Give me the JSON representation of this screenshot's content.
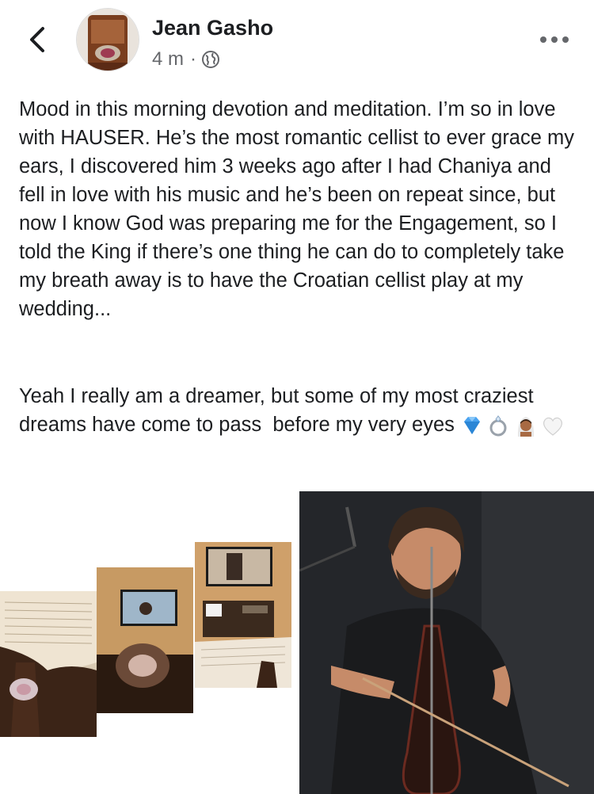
{
  "post": {
    "author_name": "Jean Gasho",
    "timestamp": "4 m",
    "separator": "·",
    "privacy_icon": "globe-icon",
    "paragraph1": "Mood in this morning devotion and meditation. I’m so in love with HAUSER. He’s the most romantic cellist to ever grace my ears, I discovered him 3 weeks ago after I had Chaniya and fell in love with his music and he’s been on repeat since, but now I know God was preparing me for the Engagement, so I told the King if there’s one thing he can do to completely take my breath away is to have the Croatian cellist play at my wedding...",
    "paragraph2": "Yeah I really am a dreamer, but some of my most craziest dreams have come to pass  before my very eyes",
    "emojis": [
      "gem-icon",
      "ring-icon",
      "bride-with-veil-icon",
      "white-heart-icon"
    ]
  },
  "icons": {
    "back": "chevron-left-icon",
    "more": "more-horizontal-icon"
  },
  "colors": {
    "text": "#1c1e21",
    "secondary": "#65676b",
    "background": "#ffffff"
  }
}
